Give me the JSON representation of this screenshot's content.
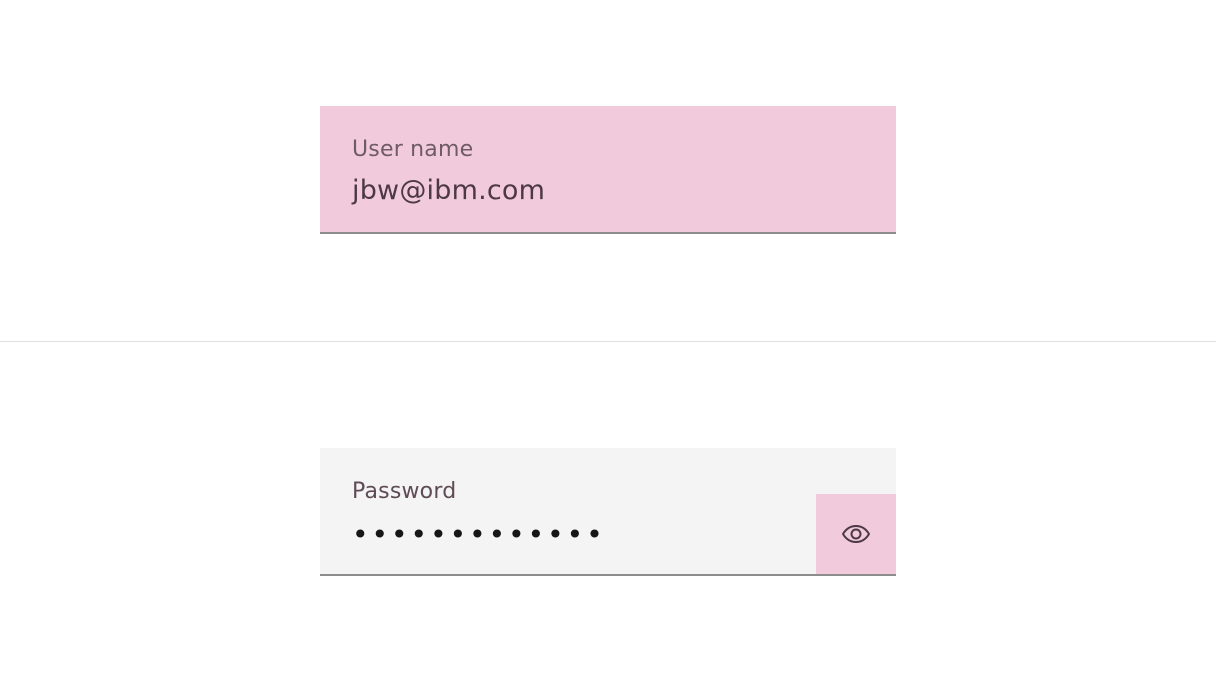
{
  "username_field": {
    "label": "User name",
    "value": "jbw@ibm.com"
  },
  "password_field": {
    "label": "Password",
    "masked_value": "•••••••••••••",
    "toggle_icon": "eye-icon"
  },
  "colors": {
    "highlight": "#f1cadb",
    "field_background": "#f4f4f4",
    "field_border": "#8d8d8d",
    "divider": "#e0e0e0",
    "label_text": "#6f5b67",
    "value_text": "#4d3847",
    "icon": "#4d3847"
  }
}
